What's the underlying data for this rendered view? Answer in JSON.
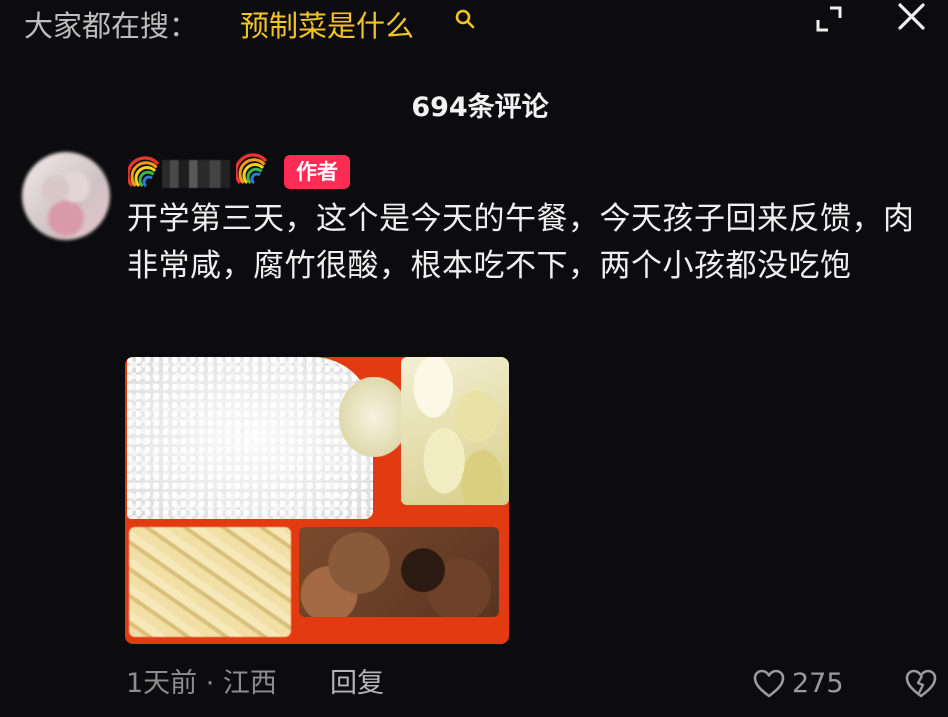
{
  "search_bar": {
    "prefix": "大家都在搜：",
    "term": "预制菜是什么"
  },
  "header": {
    "comment_count": "694条评论"
  },
  "comment": {
    "author_badge": "作者",
    "text": "开学第三天，这个是今天的午餐，今天孩子回来反馈，肉非常咸，腐竹很酸，根本吃不下，两个小孩都没吃饱",
    "time_location": "1天前 · 江西",
    "reply_label": "回复",
    "like_count": "275"
  },
  "colors": {
    "background": "#0c0c0e",
    "search_term": "#f3c42a",
    "author_badge": "#fe2c55",
    "tray": "#e23b12"
  }
}
